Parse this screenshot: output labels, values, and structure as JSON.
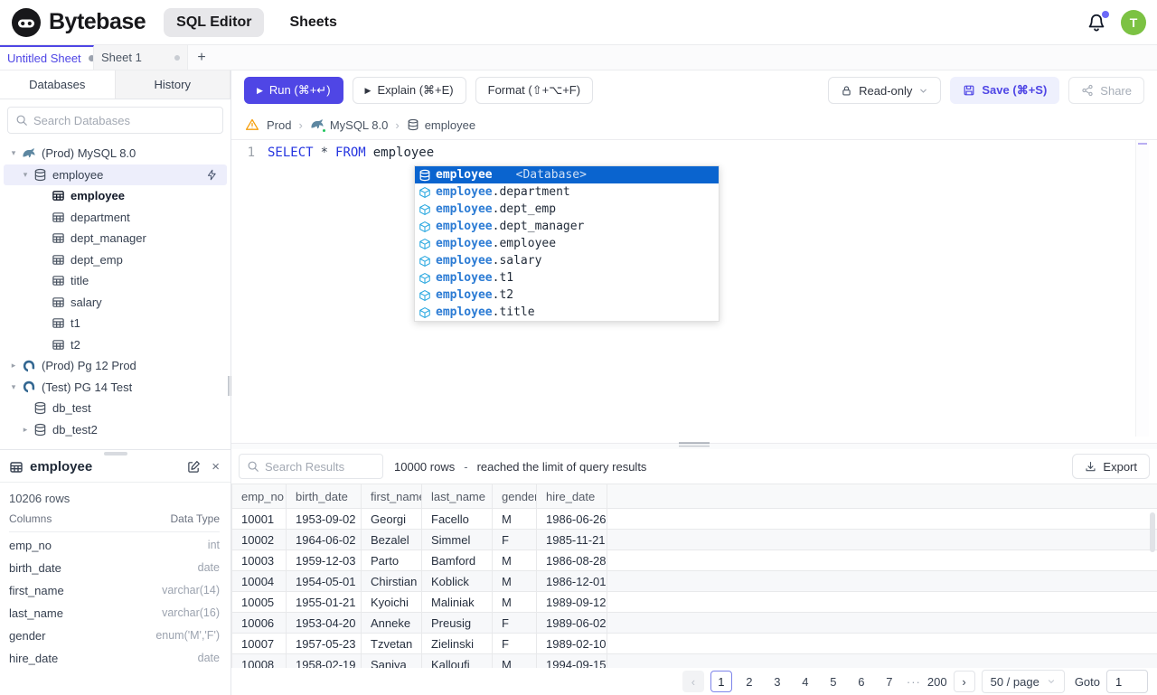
{
  "colors": {
    "accent": "#4f46e5",
    "keyword_blue": "#2535e0",
    "suggest_selected": "#0a64cf",
    "suggest_match": "#2b7bd4",
    "avatar_green": "#7cc243",
    "mysql_icon": "#5d87a1",
    "postgres_icon": "#336791",
    "warning_amber": "#f59e0b",
    "status_green": "#22c55e"
  },
  "topbar": {
    "brand": "Bytebase",
    "nav_sql_editor": "SQL Editor",
    "nav_sheets": "Sheets",
    "avatar_initial": "T"
  },
  "tabbar": {
    "tabs": [
      {
        "label": "Untitled Sheet"
      },
      {
        "label": "Sheet 1"
      }
    ],
    "add_label": "+"
  },
  "sidebar": {
    "tab_databases": "Databases",
    "tab_history": "History",
    "search_placeholder": "Search Databases",
    "tree": [
      {
        "label": "(Prod) MySQL 8.0"
      },
      {
        "label": "employee"
      },
      {
        "label": "employee"
      },
      {
        "label": "department"
      },
      {
        "label": "dept_manager"
      },
      {
        "label": "dept_emp"
      },
      {
        "label": "title"
      },
      {
        "label": "salary"
      },
      {
        "label": "t1"
      },
      {
        "label": "t2"
      },
      {
        "label": "(Prod) Pg 12 Prod"
      },
      {
        "label": "(Test) PG 14 Test"
      },
      {
        "label": "db_test"
      },
      {
        "label": "db_test2"
      }
    ]
  },
  "schema_panel": {
    "title": "employee",
    "row_count": "10206 rows",
    "columns_label": "Columns",
    "datatype_label": "Data Type",
    "columns": [
      {
        "name": "emp_no",
        "type": "int"
      },
      {
        "name": "birth_date",
        "type": "date"
      },
      {
        "name": "first_name",
        "type": "varchar(14)"
      },
      {
        "name": "last_name",
        "type": "varchar(16)"
      },
      {
        "name": "gender",
        "type": "enum('M','F')"
      },
      {
        "name": "hire_date",
        "type": "date"
      }
    ]
  },
  "toolbar": {
    "run": "Run (⌘+↵)",
    "explain": "Explain (⌘+E)",
    "format": "Format (⇧+⌥+F)",
    "readonly": "Read-only",
    "save": "Save (⌘+S)",
    "share": "Share"
  },
  "breadcrumb": {
    "env": "Prod",
    "instance": "MySQL 8.0",
    "database": "employee"
  },
  "editor": {
    "line_number": "1",
    "kw1": "SELECT",
    "op": "*",
    "kw2": "FROM",
    "table": "employee"
  },
  "autocomplete": {
    "selected": {
      "label": "employee",
      "detail": "<Database>"
    },
    "items": [
      {
        "prefix": "employee",
        "suffix": ".department"
      },
      {
        "prefix": "employee",
        "suffix": ".dept_emp"
      },
      {
        "prefix": "employee",
        "suffix": ".dept_manager"
      },
      {
        "prefix": "employee",
        "suffix": ".employee"
      },
      {
        "prefix": "employee",
        "suffix": ".salary"
      },
      {
        "prefix": "employee",
        "suffix": ".t1"
      },
      {
        "prefix": "employee",
        "suffix": ".t2"
      },
      {
        "prefix": "employee",
        "suffix": ".title"
      }
    ]
  },
  "results": {
    "search_placeholder": "Search Results",
    "row_count": "10000 rows",
    "separator": "-",
    "limit_note": "reached the limit of query results",
    "export_label": "Export",
    "headers": [
      "emp_no",
      "birth_date",
      "first_name",
      "last_name",
      "gender",
      "hire_date"
    ],
    "rows": [
      [
        "10001",
        "1953-09-02",
        "Georgi",
        "Facello",
        "M",
        "1986-06-26"
      ],
      [
        "10002",
        "1964-06-02",
        "Bezalel",
        "Simmel",
        "F",
        "1985-11-21"
      ],
      [
        "10003",
        "1959-12-03",
        "Parto",
        "Bamford",
        "M",
        "1986-08-28"
      ],
      [
        "10004",
        "1954-05-01",
        "Chirstian",
        "Koblick",
        "M",
        "1986-12-01"
      ],
      [
        "10005",
        "1955-01-21",
        "Kyoichi",
        "Maliniak",
        "M",
        "1989-09-12"
      ],
      [
        "10006",
        "1953-04-20",
        "Anneke",
        "Preusig",
        "F",
        "1989-06-02"
      ],
      [
        "10007",
        "1957-05-23",
        "Tzvetan",
        "Zielinski",
        "F",
        "1989-02-10"
      ],
      [
        "10008",
        "1958-02-19",
        "Saniya",
        "Kalloufi",
        "M",
        "1994-09-15"
      ]
    ]
  },
  "pagination": {
    "prev": "‹",
    "next": "›",
    "pages": [
      "1",
      "2",
      "3",
      "4",
      "5",
      "6",
      "7"
    ],
    "ellipsis": "···",
    "last_page": "200",
    "page_size": "50 / page",
    "goto_label": "Goto",
    "goto_value": "1"
  }
}
